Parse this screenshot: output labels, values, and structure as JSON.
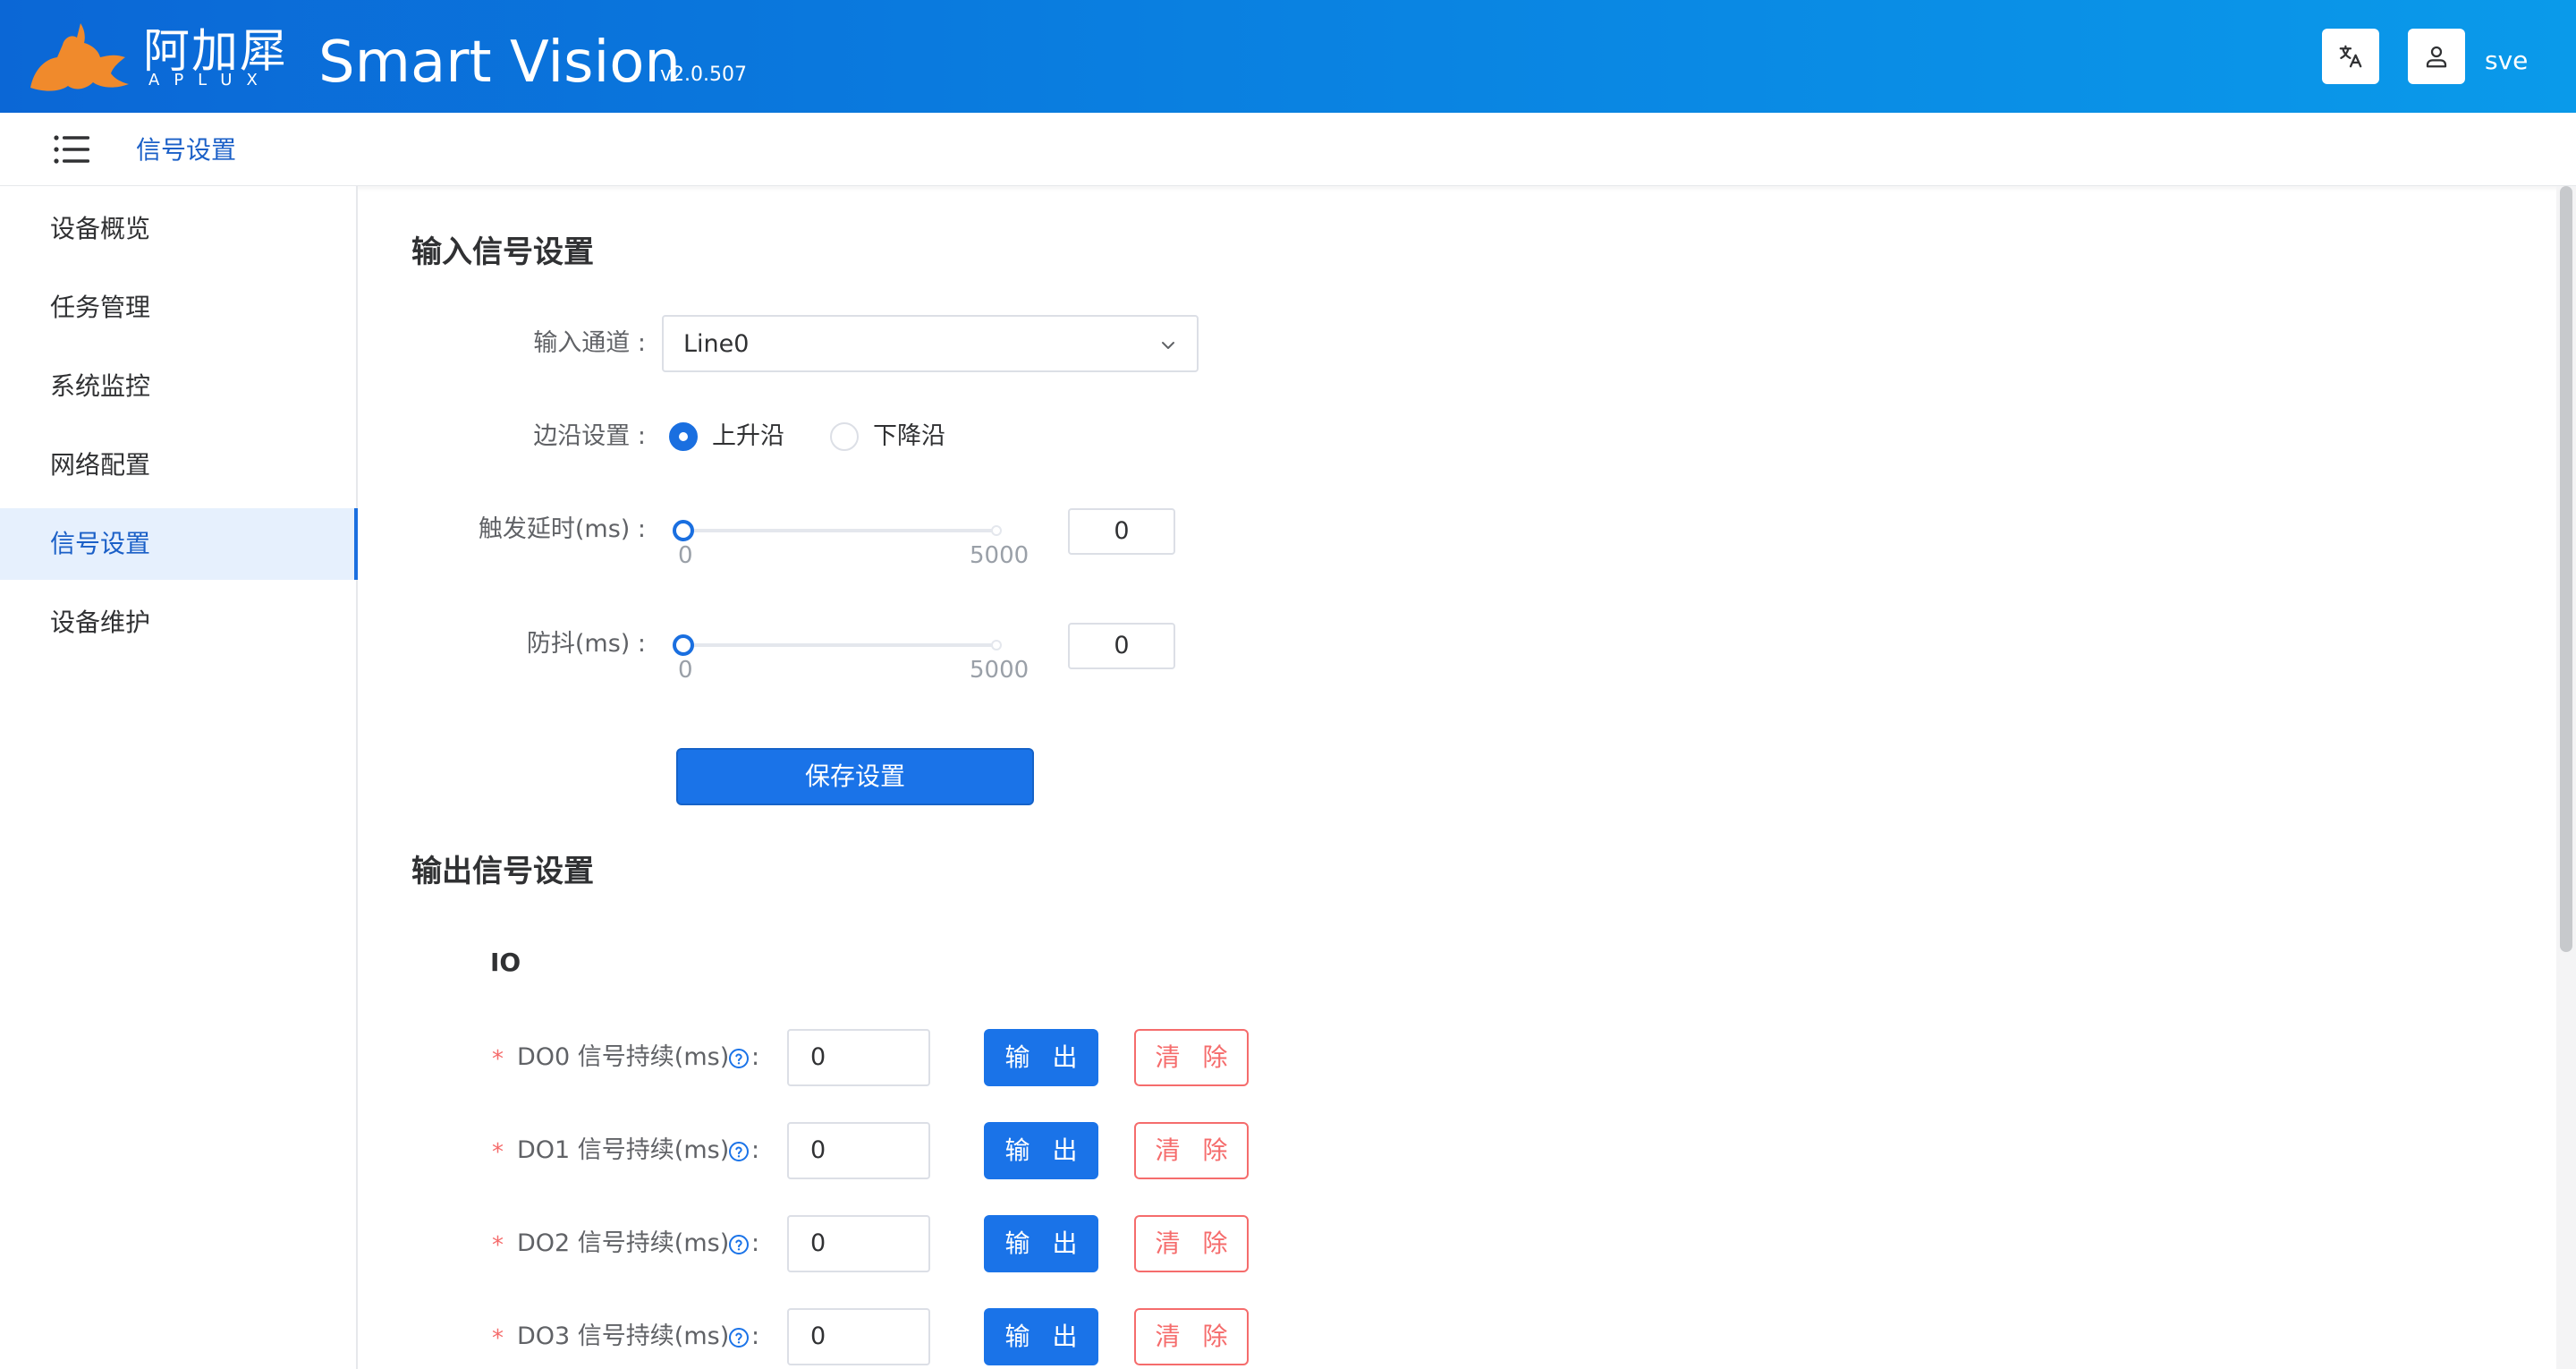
{
  "header": {
    "logo_cn": "阿加犀",
    "logo_en": "APLUX",
    "app_title": "Smart Vision",
    "version": "v2.0.507",
    "translate_icon": "translate-icon",
    "user_icon": "user-icon",
    "username": "sve"
  },
  "breadcrumb": {
    "menu_icon": "menu-icon",
    "current": "信号设置"
  },
  "sidebar": {
    "items": [
      {
        "label": "设备概览",
        "active": false
      },
      {
        "label": "任务管理",
        "active": false
      },
      {
        "label": "系统监控",
        "active": false
      },
      {
        "label": "网络配置",
        "active": false
      },
      {
        "label": "信号设置",
        "active": true
      },
      {
        "label": "设备维护",
        "active": false
      }
    ]
  },
  "input_section": {
    "title": "输入信号设置",
    "channel": {
      "label": "输入通道 :",
      "value": "Line0"
    },
    "edge": {
      "label": "边沿设置 :",
      "options": [
        {
          "label": "上升沿",
          "checked": true
        },
        {
          "label": "下降沿",
          "checked": false
        }
      ]
    },
    "trigger_delay": {
      "label": "触发延时(ms) :",
      "min": "0",
      "max": "5000",
      "value": "0"
    },
    "debounce": {
      "label": "防抖(ms) :",
      "min": "0",
      "max": "5000",
      "value": "0"
    },
    "save_label": "保存设置"
  },
  "output_section": {
    "title": "输出信号设置",
    "subtitle": "IO",
    "required_mark": "*",
    "colon": ":",
    "output_label": "输 出",
    "clear_label": "清 除",
    "rows": [
      {
        "label": "DO0 信号持续(ms)",
        "value": "0"
      },
      {
        "label": "DO1 信号持续(ms)",
        "value": "0"
      },
      {
        "label": "DO2 信号持续(ms)",
        "value": "0"
      },
      {
        "label": "DO3 信号持续(ms)",
        "value": "0"
      }
    ]
  },
  "colors": {
    "header_start": "#0b67d6",
    "header_end": "#0a9aea",
    "primary": "#1a73e8",
    "danger": "#f56c6c",
    "logo_orange": "#f08a2c"
  }
}
